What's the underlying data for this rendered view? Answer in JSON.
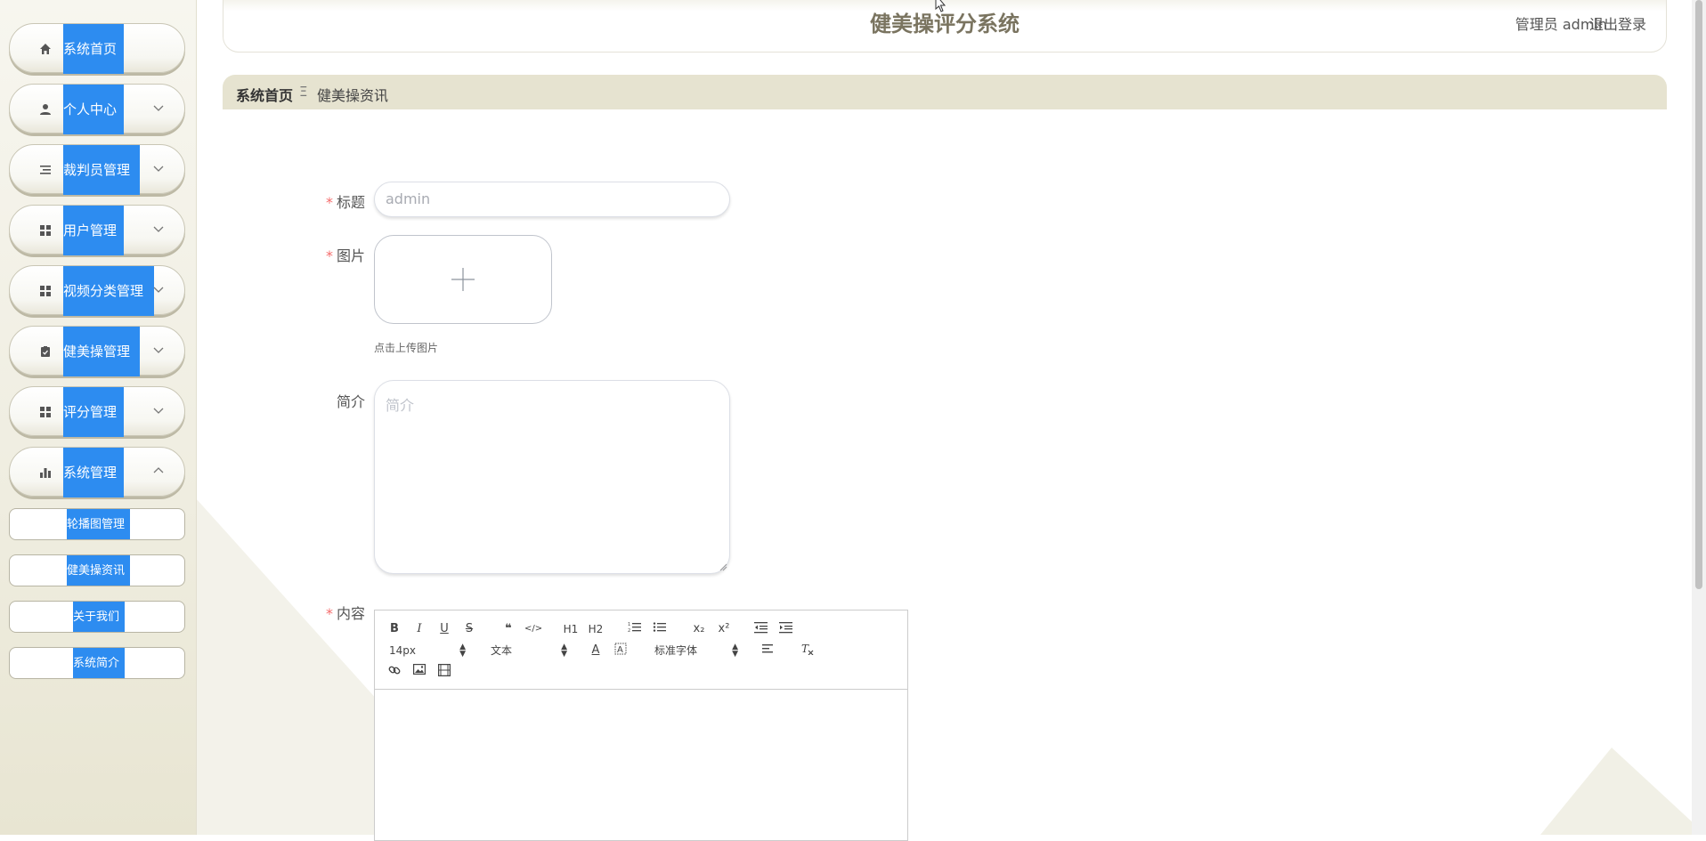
{
  "header": {
    "title": "健美操评分系统",
    "user": "管理员 admin",
    "logout": "退出登录"
  },
  "breadcrumb": {
    "home": "系统首页",
    "separator": "Ξ",
    "current": "健美操资讯"
  },
  "sidebar": {
    "items": [
      {
        "label": "系统首页",
        "icon": "home-icon"
      },
      {
        "label": "个人中心",
        "icon": "user-icon"
      },
      {
        "label": "裁判员管理",
        "icon": "list-icon"
      },
      {
        "label": "用户管理",
        "icon": "grid-icon"
      },
      {
        "label": "视频分类管理",
        "icon": "grid-icon"
      },
      {
        "label": "健美操管理",
        "icon": "clipboard-icon"
      },
      {
        "label": "评分管理",
        "icon": "grid-icon"
      },
      {
        "label": "系统管理",
        "icon": "bar-chart-icon"
      }
    ],
    "sub_items": [
      {
        "label": "轮播图管理"
      },
      {
        "label": "健美操资讯"
      },
      {
        "label": "关于我们"
      },
      {
        "label": "系统简介"
      }
    ]
  },
  "form": {
    "title_label": "标题",
    "title_value": "admin",
    "image_label": "图片",
    "upload_tip": "点击上传图片",
    "intro_label": "简介",
    "intro_placeholder": "简介",
    "content_label": "内容",
    "required_mark": "*"
  },
  "editor": {
    "font_size": "14px",
    "text_type": "文本",
    "font_family": "标准字体",
    "toolbar_buttons": [
      "B",
      "I",
      "U",
      "S",
      "❝",
      "</>",
      "H1",
      "H2",
      "ordered-list",
      "bullet-list",
      "x₂",
      "x²",
      "outdent",
      "indent",
      "A",
      "highlight",
      "align",
      "clear-format",
      "link",
      "image",
      "video"
    ]
  },
  "colors": {
    "accent": "#2d8cf0",
    "sidebar_bg": "#efede0",
    "title_color": "#7a7460",
    "breadcrumb_bg": "#e6e3d0",
    "required": "#f56c6c"
  }
}
